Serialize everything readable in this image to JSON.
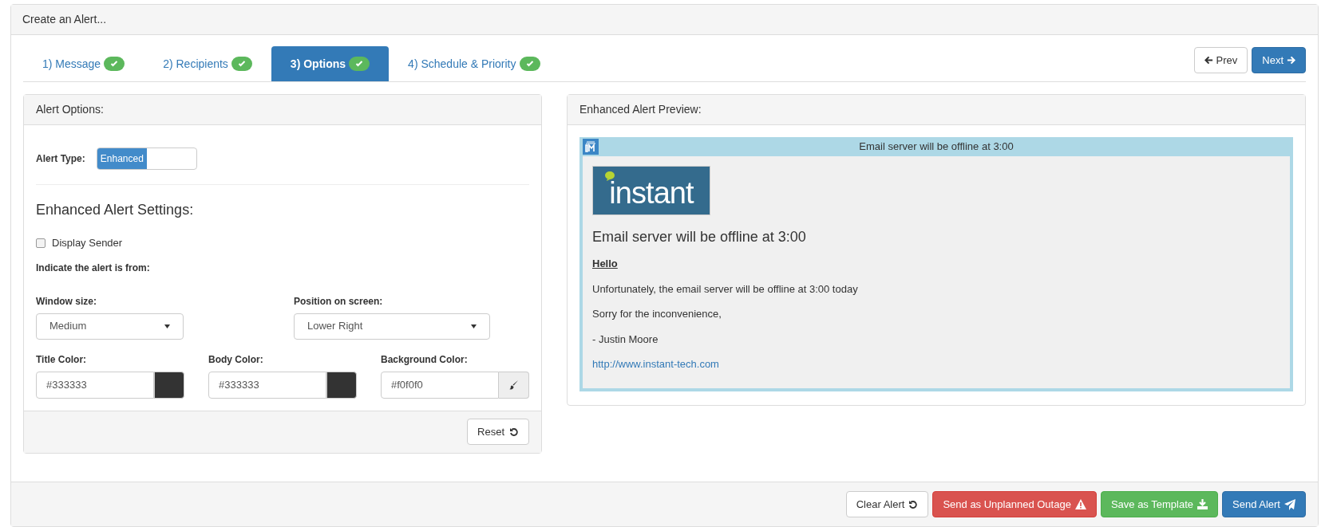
{
  "window": {
    "title": "Create an Alert..."
  },
  "tabs": [
    {
      "label": "1) Message",
      "complete": true,
      "selected": false
    },
    {
      "label": "2) Recipients",
      "complete": true,
      "selected": false
    },
    {
      "label": "3) Options",
      "complete": true,
      "selected": true
    },
    {
      "label": "4) Schedule & Priority",
      "complete": true,
      "selected": false
    }
  ],
  "nav_buttons": {
    "prev": "Prev",
    "next": "Next"
  },
  "options_panel": {
    "title": "Alert Options:",
    "alert_type": {
      "label": "Alert Type:",
      "value": "Enhanced",
      "on": true
    },
    "settings_title": "Enhanced Alert Settings:",
    "display_sender": {
      "label": "Display Sender",
      "checked": false
    },
    "from_label": "Indicate the alert is from:",
    "window_size": {
      "label": "Window size:",
      "value": "Medium"
    },
    "position": {
      "label": "Position on screen:",
      "value": "Lower Right"
    },
    "colors": [
      {
        "label": "Title Color:",
        "value": "#333333",
        "color": "#333333",
        "kind": "swatch"
      },
      {
        "label": "Body Color:",
        "value": "#333333",
        "color": "#333333",
        "kind": "swatch"
      },
      {
        "label": "Background Color:",
        "value": "#f0f0f0",
        "kind": "picker"
      }
    ],
    "reset": "Reset"
  },
  "preview_panel": {
    "title": "Enhanced Alert Preview:",
    "bar_title": "Email server will be offline at 3:00",
    "logo_text": "instant",
    "heading": "Email server will be offline at 3:00",
    "greeting": "Hello",
    "paragraphs": [
      "Unfortunately, the email server will be offline at 3:00 today",
      "Sorry for the inconvenience,",
      "- Justin Moore"
    ],
    "link": "http://www.instant-tech.com"
  },
  "footer_buttons": [
    {
      "label": "Clear Alert",
      "kind": "clear"
    },
    {
      "label": "Send as Unplanned Outage",
      "kind": "outage"
    },
    {
      "label": "Save as Template",
      "kind": "template"
    },
    {
      "label": "Send Alert",
      "kind": "send"
    }
  ]
}
